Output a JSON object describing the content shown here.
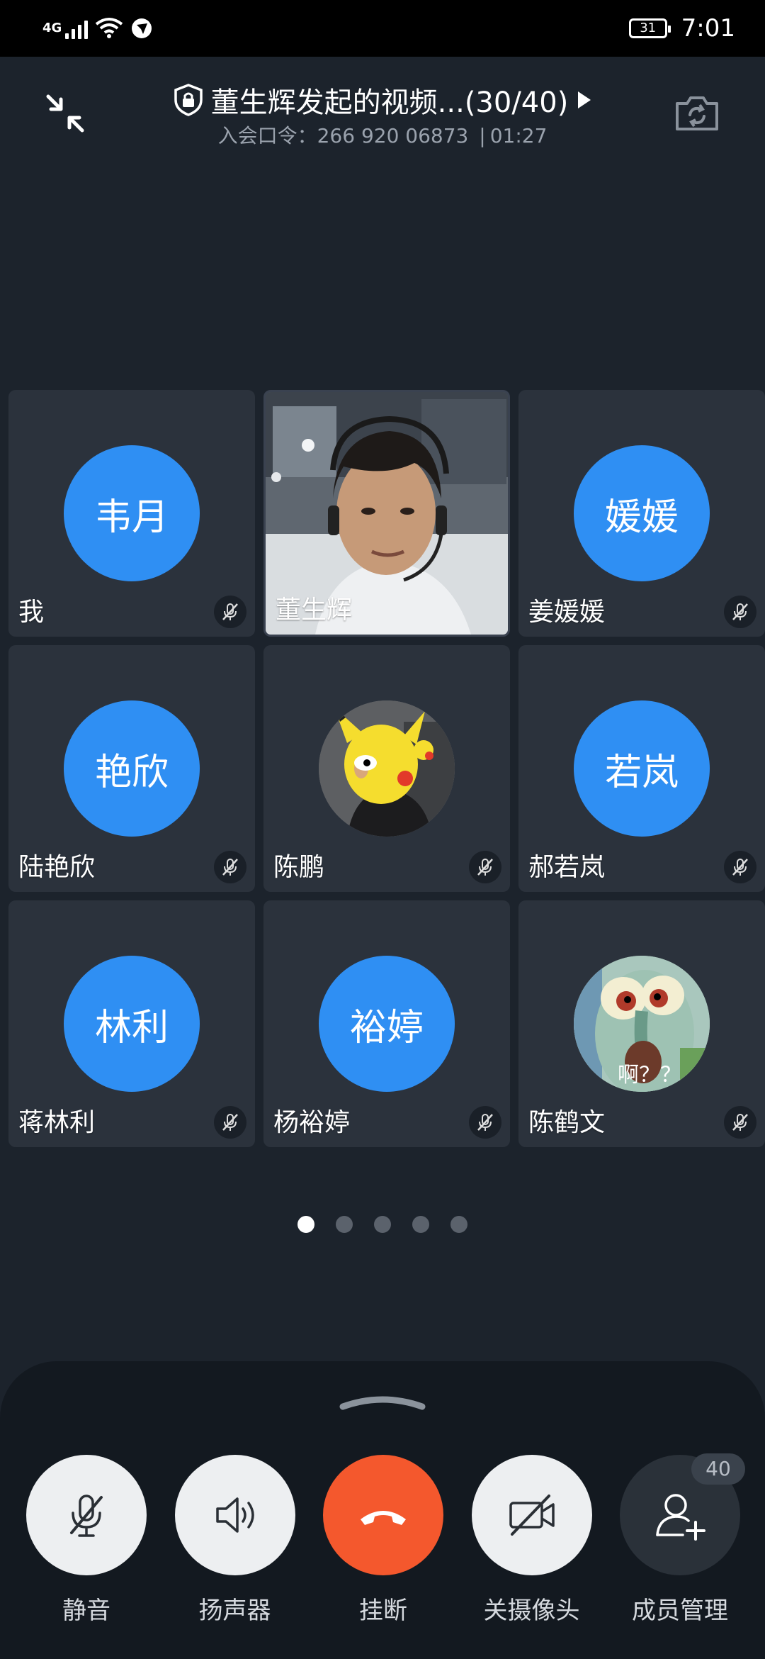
{
  "status_bar": {
    "network_type": "4G",
    "battery": "31",
    "time": "7:01",
    "icons": [
      "signal-icon",
      "wifi-icon",
      "vpn-icon"
    ]
  },
  "header": {
    "title": "董生辉发起的视频...(30/40)",
    "passcode_label": "入会口令：",
    "passcode": "266 920 06873",
    "separator": "|",
    "duration": "01:27",
    "icons": [
      "collapse-icon",
      "lock-shield-icon",
      "play-arrow-icon",
      "camera-switch-icon"
    ]
  },
  "participants": [
    {
      "name": "我",
      "avatar_text": "韦月",
      "avatar_type": "initials",
      "muted": true
    },
    {
      "name": "董生辉",
      "avatar_text": "",
      "avatar_type": "video",
      "muted": false
    },
    {
      "name": "姜媛媛",
      "avatar_text": "媛媛",
      "avatar_type": "initials",
      "muted": true
    },
    {
      "name": "陆艳欣",
      "avatar_text": "艳欣",
      "avatar_type": "initials",
      "muted": true
    },
    {
      "name": "陈鹏",
      "avatar_text": "",
      "avatar_type": "photo",
      "muted": true
    },
    {
      "name": "郝若岚",
      "avatar_text": "若岚",
      "avatar_type": "initials",
      "muted": true
    },
    {
      "name": "蒋林利",
      "avatar_text": "林利",
      "avatar_type": "initials",
      "muted": true
    },
    {
      "name": "杨裕婷",
      "avatar_text": "裕婷",
      "avatar_type": "initials",
      "muted": true
    },
    {
      "name": "陈鹤文",
      "avatar_text": "啊？？",
      "avatar_type": "photo",
      "muted": true
    }
  ],
  "pager": {
    "pages": 5,
    "active": 1
  },
  "controls": [
    {
      "label": "静音",
      "icon": "mic-off-icon"
    },
    {
      "label": "扬声器",
      "icon": "speaker-icon"
    },
    {
      "label": "挂断",
      "icon": "hangup-icon"
    },
    {
      "label": "关摄像头",
      "icon": "camera-off-icon"
    },
    {
      "label": "成员管理",
      "icon": "add-member-icon",
      "badge": "40"
    }
  ],
  "colors": {
    "background": "#1c232c",
    "tile": "#2b323c",
    "avatar_blue": "#2f8ff3",
    "hangup_orange": "#f4582d",
    "panel": "#131920"
  }
}
